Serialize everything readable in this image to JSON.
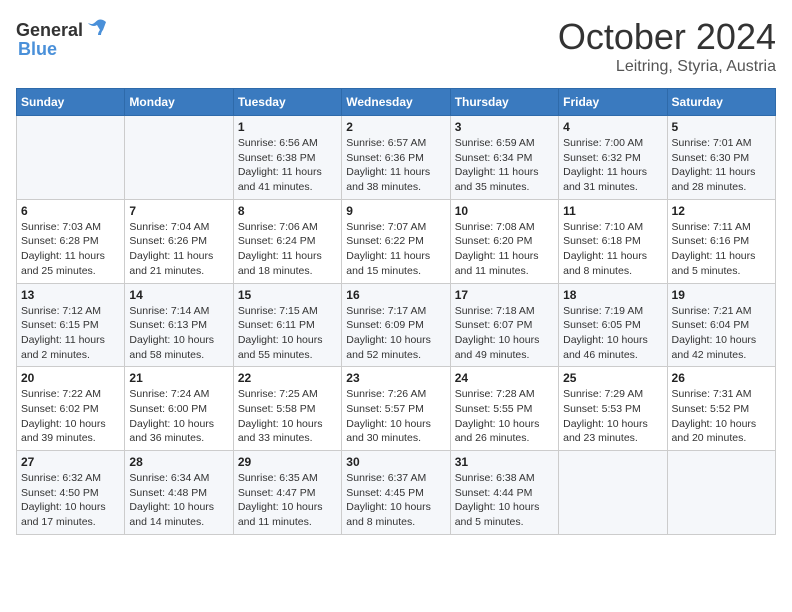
{
  "header": {
    "logo_general": "General",
    "logo_blue": "Blue",
    "title": "October 2024",
    "location": "Leitring, Styria, Austria"
  },
  "days_of_week": [
    "Sunday",
    "Monday",
    "Tuesday",
    "Wednesday",
    "Thursday",
    "Friday",
    "Saturday"
  ],
  "weeks": [
    [
      {
        "day": "",
        "info": ""
      },
      {
        "day": "",
        "info": ""
      },
      {
        "day": "1",
        "sunrise": "Sunrise: 6:56 AM",
        "sunset": "Sunset: 6:38 PM",
        "daylight": "Daylight: 11 hours and 41 minutes."
      },
      {
        "day": "2",
        "sunrise": "Sunrise: 6:57 AM",
        "sunset": "Sunset: 6:36 PM",
        "daylight": "Daylight: 11 hours and 38 minutes."
      },
      {
        "day": "3",
        "sunrise": "Sunrise: 6:59 AM",
        "sunset": "Sunset: 6:34 PM",
        "daylight": "Daylight: 11 hours and 35 minutes."
      },
      {
        "day": "4",
        "sunrise": "Sunrise: 7:00 AM",
        "sunset": "Sunset: 6:32 PM",
        "daylight": "Daylight: 11 hours and 31 minutes."
      },
      {
        "day": "5",
        "sunrise": "Sunrise: 7:01 AM",
        "sunset": "Sunset: 6:30 PM",
        "daylight": "Daylight: 11 hours and 28 minutes."
      }
    ],
    [
      {
        "day": "6",
        "sunrise": "Sunrise: 7:03 AM",
        "sunset": "Sunset: 6:28 PM",
        "daylight": "Daylight: 11 hours and 25 minutes."
      },
      {
        "day": "7",
        "sunrise": "Sunrise: 7:04 AM",
        "sunset": "Sunset: 6:26 PM",
        "daylight": "Daylight: 11 hours and 21 minutes."
      },
      {
        "day": "8",
        "sunrise": "Sunrise: 7:06 AM",
        "sunset": "Sunset: 6:24 PM",
        "daylight": "Daylight: 11 hours and 18 minutes."
      },
      {
        "day": "9",
        "sunrise": "Sunrise: 7:07 AM",
        "sunset": "Sunset: 6:22 PM",
        "daylight": "Daylight: 11 hours and 15 minutes."
      },
      {
        "day": "10",
        "sunrise": "Sunrise: 7:08 AM",
        "sunset": "Sunset: 6:20 PM",
        "daylight": "Daylight: 11 hours and 11 minutes."
      },
      {
        "day": "11",
        "sunrise": "Sunrise: 7:10 AM",
        "sunset": "Sunset: 6:18 PM",
        "daylight": "Daylight: 11 hours and 8 minutes."
      },
      {
        "day": "12",
        "sunrise": "Sunrise: 7:11 AM",
        "sunset": "Sunset: 6:16 PM",
        "daylight": "Daylight: 11 hours and 5 minutes."
      }
    ],
    [
      {
        "day": "13",
        "sunrise": "Sunrise: 7:12 AM",
        "sunset": "Sunset: 6:15 PM",
        "daylight": "Daylight: 11 hours and 2 minutes."
      },
      {
        "day": "14",
        "sunrise": "Sunrise: 7:14 AM",
        "sunset": "Sunset: 6:13 PM",
        "daylight": "Daylight: 10 hours and 58 minutes."
      },
      {
        "day": "15",
        "sunrise": "Sunrise: 7:15 AM",
        "sunset": "Sunset: 6:11 PM",
        "daylight": "Daylight: 10 hours and 55 minutes."
      },
      {
        "day": "16",
        "sunrise": "Sunrise: 7:17 AM",
        "sunset": "Sunset: 6:09 PM",
        "daylight": "Daylight: 10 hours and 52 minutes."
      },
      {
        "day": "17",
        "sunrise": "Sunrise: 7:18 AM",
        "sunset": "Sunset: 6:07 PM",
        "daylight": "Daylight: 10 hours and 49 minutes."
      },
      {
        "day": "18",
        "sunrise": "Sunrise: 7:19 AM",
        "sunset": "Sunset: 6:05 PM",
        "daylight": "Daylight: 10 hours and 46 minutes."
      },
      {
        "day": "19",
        "sunrise": "Sunrise: 7:21 AM",
        "sunset": "Sunset: 6:04 PM",
        "daylight": "Daylight: 10 hours and 42 minutes."
      }
    ],
    [
      {
        "day": "20",
        "sunrise": "Sunrise: 7:22 AM",
        "sunset": "Sunset: 6:02 PM",
        "daylight": "Daylight: 10 hours and 39 minutes."
      },
      {
        "day": "21",
        "sunrise": "Sunrise: 7:24 AM",
        "sunset": "Sunset: 6:00 PM",
        "daylight": "Daylight: 10 hours and 36 minutes."
      },
      {
        "day": "22",
        "sunrise": "Sunrise: 7:25 AM",
        "sunset": "Sunset: 5:58 PM",
        "daylight": "Daylight: 10 hours and 33 minutes."
      },
      {
        "day": "23",
        "sunrise": "Sunrise: 7:26 AM",
        "sunset": "Sunset: 5:57 PM",
        "daylight": "Daylight: 10 hours and 30 minutes."
      },
      {
        "day": "24",
        "sunrise": "Sunrise: 7:28 AM",
        "sunset": "Sunset: 5:55 PM",
        "daylight": "Daylight: 10 hours and 26 minutes."
      },
      {
        "day": "25",
        "sunrise": "Sunrise: 7:29 AM",
        "sunset": "Sunset: 5:53 PM",
        "daylight": "Daylight: 10 hours and 23 minutes."
      },
      {
        "day": "26",
        "sunrise": "Sunrise: 7:31 AM",
        "sunset": "Sunset: 5:52 PM",
        "daylight": "Daylight: 10 hours and 20 minutes."
      }
    ],
    [
      {
        "day": "27",
        "sunrise": "Sunrise: 6:32 AM",
        "sunset": "Sunset: 4:50 PM",
        "daylight": "Daylight: 10 hours and 17 minutes."
      },
      {
        "day": "28",
        "sunrise": "Sunrise: 6:34 AM",
        "sunset": "Sunset: 4:48 PM",
        "daylight": "Daylight: 10 hours and 14 minutes."
      },
      {
        "day": "29",
        "sunrise": "Sunrise: 6:35 AM",
        "sunset": "Sunset: 4:47 PM",
        "daylight": "Daylight: 10 hours and 11 minutes."
      },
      {
        "day": "30",
        "sunrise": "Sunrise: 6:37 AM",
        "sunset": "Sunset: 4:45 PM",
        "daylight": "Daylight: 10 hours and 8 minutes."
      },
      {
        "day": "31",
        "sunrise": "Sunrise: 6:38 AM",
        "sunset": "Sunset: 4:44 PM",
        "daylight": "Daylight: 10 hours and 5 minutes."
      },
      {
        "day": "",
        "info": ""
      },
      {
        "day": "",
        "info": ""
      }
    ]
  ]
}
